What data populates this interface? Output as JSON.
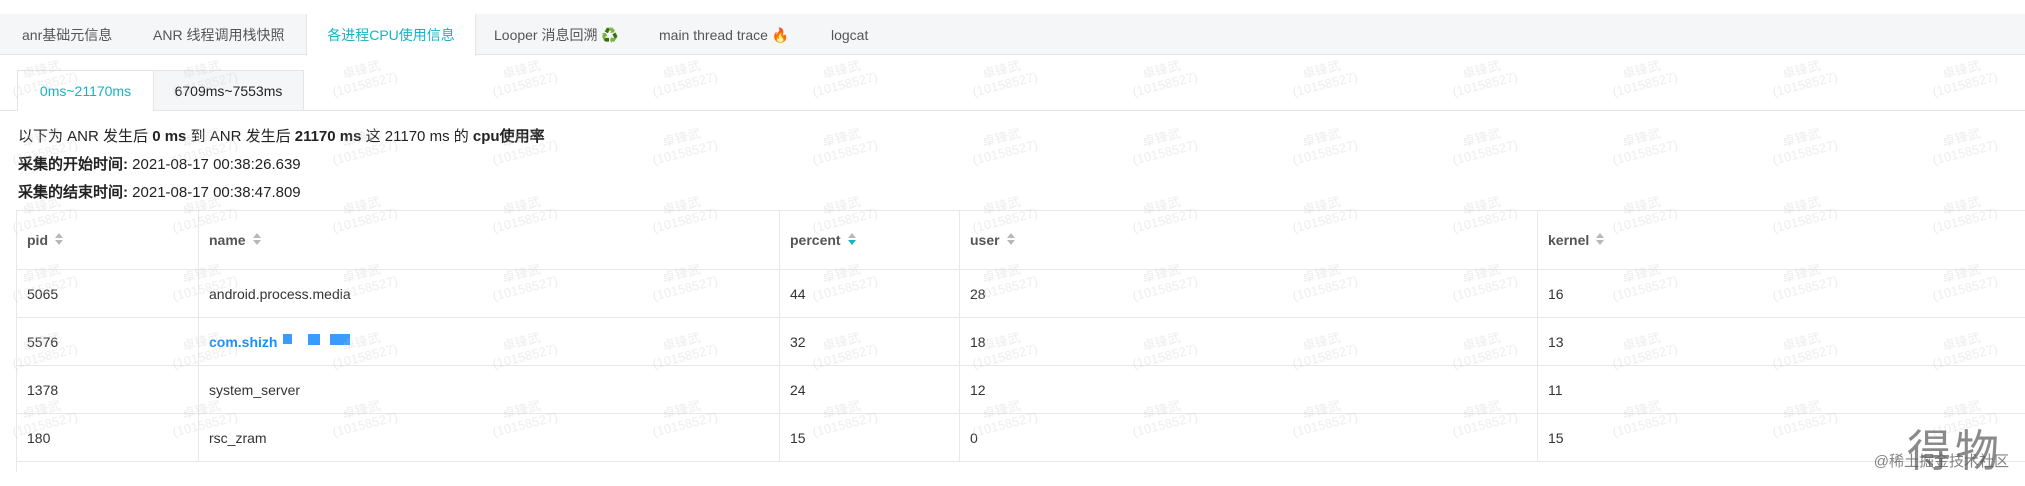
{
  "tabs": [
    {
      "label": "anr基础元信息"
    },
    {
      "label": "ANR 线程调用栈快照"
    },
    {
      "label": "各进程CPU使用信息",
      "active": true
    },
    {
      "label": "Looper 消息回溯 ♻️"
    },
    {
      "label": "main thread trace 🔥"
    },
    {
      "label": "logcat"
    }
  ],
  "subtabs": [
    {
      "label": "0ms~21170ms",
      "active": true
    },
    {
      "label": "6709ms~7553ms"
    }
  ],
  "summary": {
    "prefix": "以下为 ANR 发生后 ",
    "start_bold": "0 ms",
    "mid": " 到 ANR 发生后 ",
    "end_bold": "21170 ms",
    "suffix": " 这 21170 ms 的 ",
    "tail_bold": "cpu使用率"
  },
  "start_time": {
    "label": "采集的开始时间:",
    "value": " 2021-08-17 00:38:26.639"
  },
  "end_time": {
    "label": "采集的结束时间:",
    "value": " 2021-08-17 00:38:47.809"
  },
  "table": {
    "headers": [
      "pid",
      "name",
      "percent",
      "user",
      "kernel"
    ],
    "sorted_column": "percent",
    "rows": [
      {
        "pid": "5065",
        "name": "android.process.media",
        "percent": "44",
        "user": "28",
        "kernel": "16"
      },
      {
        "pid": "5576",
        "name": "com.shizh",
        "percent": "32",
        "user": "18",
        "kernel": "13",
        "link": true
      },
      {
        "pid": "1378",
        "name": "system_server",
        "percent": "24",
        "user": "12",
        "kernel": "11"
      },
      {
        "pid": "180",
        "name": "rsc_zram",
        "percent": "15",
        "user": "0",
        "kernel": "15"
      }
    ]
  },
  "watermark": {
    "line1": "卓锋武",
    "line2": "(10158527)"
  },
  "footer": {
    "logo": "得物",
    "credit": "@稀土掘金技术社区"
  },
  "colors": {
    "accent": "#14b4c4",
    "link": "#1890ff"
  }
}
